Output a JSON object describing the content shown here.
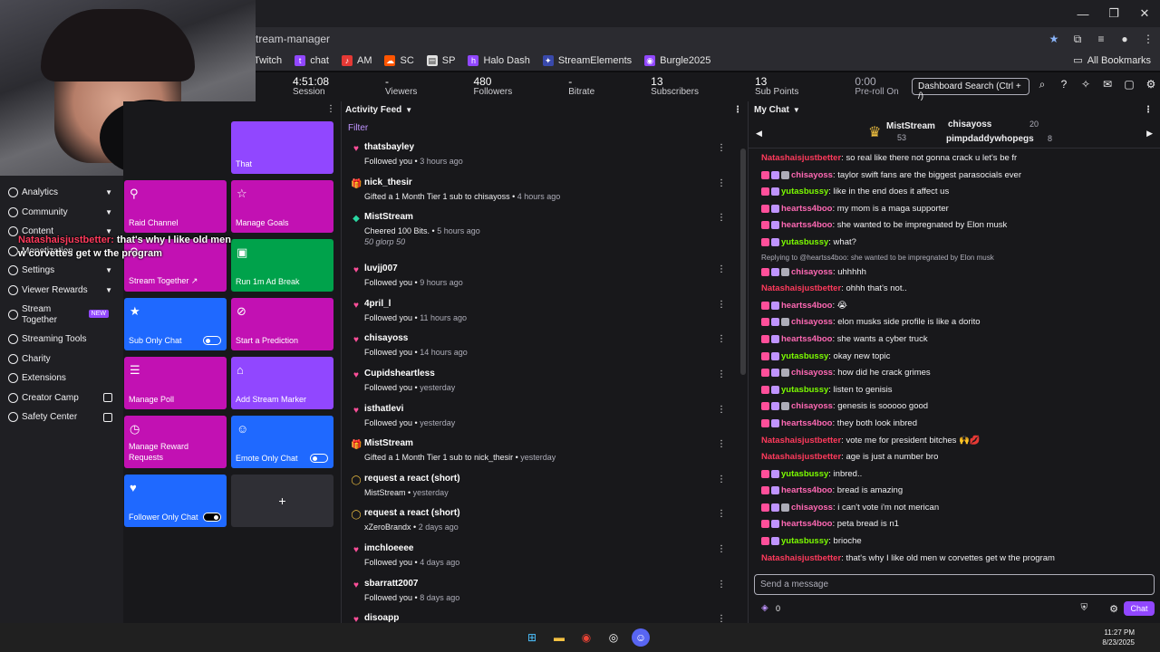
{
  "browser": {
    "url": "tream-manager",
    "bookmarks": [
      "Twitch",
      "chat",
      "AM",
      "SC",
      "SP",
      "Halo Dash",
      "StreamElements",
      "Burgle2025"
    ],
    "all_bookmarks": "All Bookmarks"
  },
  "stats": [
    {
      "value": "4:51:08",
      "label": "Session"
    },
    {
      "value": "-",
      "label": "Viewers"
    },
    {
      "value": "480",
      "label": "Followers"
    },
    {
      "value": "-",
      "label": "Bitrate"
    },
    {
      "value": "13",
      "label": "Subscribers"
    },
    {
      "value": "13",
      "label": "Sub Points"
    },
    {
      "value": "0:00",
      "label": "Pre-roll On"
    }
  ],
  "dashboard_search": "Dashboard Search (Ctrl + /)",
  "sidebar": {
    "items": [
      {
        "label": "Analytics",
        "trail": "chev"
      },
      {
        "label": "Community",
        "trail": "chev"
      },
      {
        "label": "Content",
        "trail": "chev"
      },
      {
        "label": "Monetization",
        "trail": "chev"
      },
      {
        "label": "Settings",
        "trail": "chev"
      },
      {
        "label": "Viewer Rewards",
        "trail": "chev"
      },
      {
        "label": "Stream Together",
        "trail": "new"
      },
      {
        "label": "Streaming Tools",
        "trail": ""
      },
      {
        "label": "Charity",
        "trail": ""
      },
      {
        "label": "Extensions",
        "trail": ""
      },
      {
        "label": "Creator Camp",
        "trail": "ext"
      },
      {
        "label": "Safety Center",
        "trail": "ext"
      }
    ],
    "new_badge": "NEW"
  },
  "overlay": {
    "user": "Natashaisjustbetter:",
    "line1": " that's why I like old men",
    "line2": "w corvettes get w the program"
  },
  "quick_actions": [
    {
      "label": "That",
      "color": "purple"
    },
    {
      "label": "Raid Channel",
      "color": "pink"
    },
    {
      "label": "Manage Goals",
      "color": "pink"
    },
    {
      "label": "Stream Together ↗",
      "color": "pink"
    },
    {
      "label": "Run 1m Ad Break",
      "color": "green"
    },
    {
      "label": "Sub Only Chat",
      "color": "blue"
    },
    {
      "label": "Start a Prediction",
      "color": "pink"
    },
    {
      "label": "Manage Poll",
      "color": "pink"
    },
    {
      "label": "Add Stream Marker",
      "color": "purple"
    },
    {
      "label": "Manage Reward Requests",
      "color": "pink"
    },
    {
      "label": "Emote Only Chat",
      "color": "blue"
    },
    {
      "label": "Follower Only Chat",
      "color": "blue"
    },
    {
      "label": "+",
      "color": "grey"
    }
  ],
  "activity": {
    "title": "Activity Feed",
    "filter": "Filter",
    "events": [
      {
        "icon": "heart",
        "name": "thatsbayley",
        "desc": "Followed you",
        "time": "3 hours ago"
      },
      {
        "icon": "gift",
        "name": "nick_thesir",
        "desc": "Gifted a 1 Month Tier 1 sub to chisayoss",
        "time": "4 hours ago"
      },
      {
        "icon": "bits",
        "name": "MistStream",
        "desc": "Cheered 100 Bits.",
        "time": "5 hours ago",
        "cheer": "50 glorp  50"
      },
      {
        "icon": "heart",
        "name": "luvjj007",
        "desc": "Followed you",
        "time": "9 hours ago"
      },
      {
        "icon": "heart",
        "name": "4pril_l",
        "desc": "Followed you",
        "time": "11 hours ago"
      },
      {
        "icon": "heart",
        "name": "chisayoss",
        "desc": "Followed you",
        "time": "14 hours ago"
      },
      {
        "icon": "heart",
        "name": "Cupidsheartless",
        "desc": "Followed you",
        "time": "yesterday"
      },
      {
        "icon": "heart",
        "name": "isthatlevi",
        "desc": "Followed you",
        "time": "yesterday"
      },
      {
        "icon": "gift",
        "name": "MistStream",
        "desc": "Gifted a 1 Month Tier 1 sub to nick_thesir",
        "time": "yesterday"
      },
      {
        "icon": "reward",
        "name": "request a react (short)",
        "desc": "MistStream",
        "time": "yesterday"
      },
      {
        "icon": "reward",
        "name": "request a react (short)",
        "desc": "xZeroBrandx",
        "time": "2 days ago"
      },
      {
        "icon": "heart",
        "name": "imchloeeee",
        "desc": "Followed you",
        "time": "4 days ago"
      },
      {
        "icon": "heart",
        "name": "sbarratt2007",
        "desc": "Followed you",
        "time": "8 days ago"
      },
      {
        "icon": "heart",
        "name": "disoapp",
        "desc": "",
        "time": ""
      }
    ]
  },
  "chat": {
    "title": "My Chat",
    "hype": {
      "left_name": "MistStream",
      "left_count": "53",
      "right1": "chisayoss",
      "right1_count": "20",
      "right2": "pimpdaddywhopegs",
      "right2_count": "8"
    },
    "messages": [
      {
        "user": "Natashaisjustbetter",
        "text": ": so real like there not gonna crack u let's be fr",
        "color": "#ff3a5c",
        "badges": 0
      },
      {
        "user": "chisayoss",
        "text": ": taylor swift fans are the biggest parasocials ever",
        "color": "#ff69b4",
        "badges": 3
      },
      {
        "user": "yutasbussy",
        "text": ": like in the end does it affect us",
        "color": "#7cfc00",
        "badges": 2
      },
      {
        "user": "heartss4boo",
        "text": ": my mom is a maga supporter",
        "color": "#ff69b4",
        "badges": 2
      },
      {
        "user": "heartss4boo",
        "text": ": she wanted to be impregnated by Elon musk",
        "color": "#ff69b4",
        "badges": 2
      },
      {
        "user": "yutasbussy",
        "text": ": what?",
        "color": "#7cfc00",
        "badges": 2
      },
      {
        "reply": "Replying to @heartss4boo: she wanted to be impregnated by Elon musk"
      },
      {
        "user": "chisayoss",
        "text": ": uhhhhh",
        "color": "#ff69b4",
        "badges": 3
      },
      {
        "user": "Natashaisjustbetter",
        "text": ": ohhh that's not..",
        "color": "#ff3a5c",
        "badges": 0
      },
      {
        "user": "heartss4boo",
        "text": ": 😭",
        "color": "#ff69b4",
        "badges": 2
      },
      {
        "user": "chisayoss",
        "text": ": elon musks side profile is like a dorito",
        "color": "#ff69b4",
        "badges": 3
      },
      {
        "user": "heartss4boo",
        "text": ": she wants a cyber truck",
        "color": "#ff69b4",
        "badges": 2
      },
      {
        "user": "yutasbussy",
        "text": ": okay new topic",
        "color": "#7cfc00",
        "badges": 2
      },
      {
        "user": "chisayoss",
        "text": ": how did he crack grimes",
        "color": "#ff69b4",
        "badges": 3
      },
      {
        "user": "yutasbussy",
        "text": ": listen to genisis",
        "color": "#7cfc00",
        "badges": 2
      },
      {
        "user": "chisayoss",
        "text": ": genesis is sooooo good",
        "color": "#ff69b4",
        "badges": 3
      },
      {
        "user": "heartss4boo",
        "text": ": they both look inbred",
        "color": "#ff69b4",
        "badges": 2
      },
      {
        "user": "Natashaisjustbetter",
        "text": ": vote me for president bitches 🙌💋",
        "color": "#ff3a5c",
        "badges": 0
      },
      {
        "user": "Natashaisjustbetter",
        "text": ": age is just a number bro",
        "color": "#ff3a5c",
        "badges": 0
      },
      {
        "user": "yutasbussy",
        "text": ": inbred..",
        "color": "#7cfc00",
        "badges": 2
      },
      {
        "user": "heartss4boo",
        "text": ": bread is amazing",
        "color": "#ff69b4",
        "badges": 2
      },
      {
        "user": "chisayoss",
        "text": ": i can't vote i'm not merican",
        "color": "#ff69b4",
        "badges": 3
      },
      {
        "user": "heartss4boo",
        "text": ": peta bread is n1",
        "color": "#ff69b4",
        "badges": 2
      },
      {
        "user": "yutasbussy",
        "text": ": brioche",
        "color": "#7cfc00",
        "badges": 2
      },
      {
        "user": "Natashaisjustbetter",
        "text": ": that's why I like old men w corvettes get w the program",
        "color": "#ff3a5c",
        "badges": 0
      }
    ],
    "input_placeholder": "Send a message",
    "points": "0",
    "chat_button": "Chat"
  },
  "clock": {
    "time": "11:27 PM",
    "date": "8/23/2025"
  }
}
